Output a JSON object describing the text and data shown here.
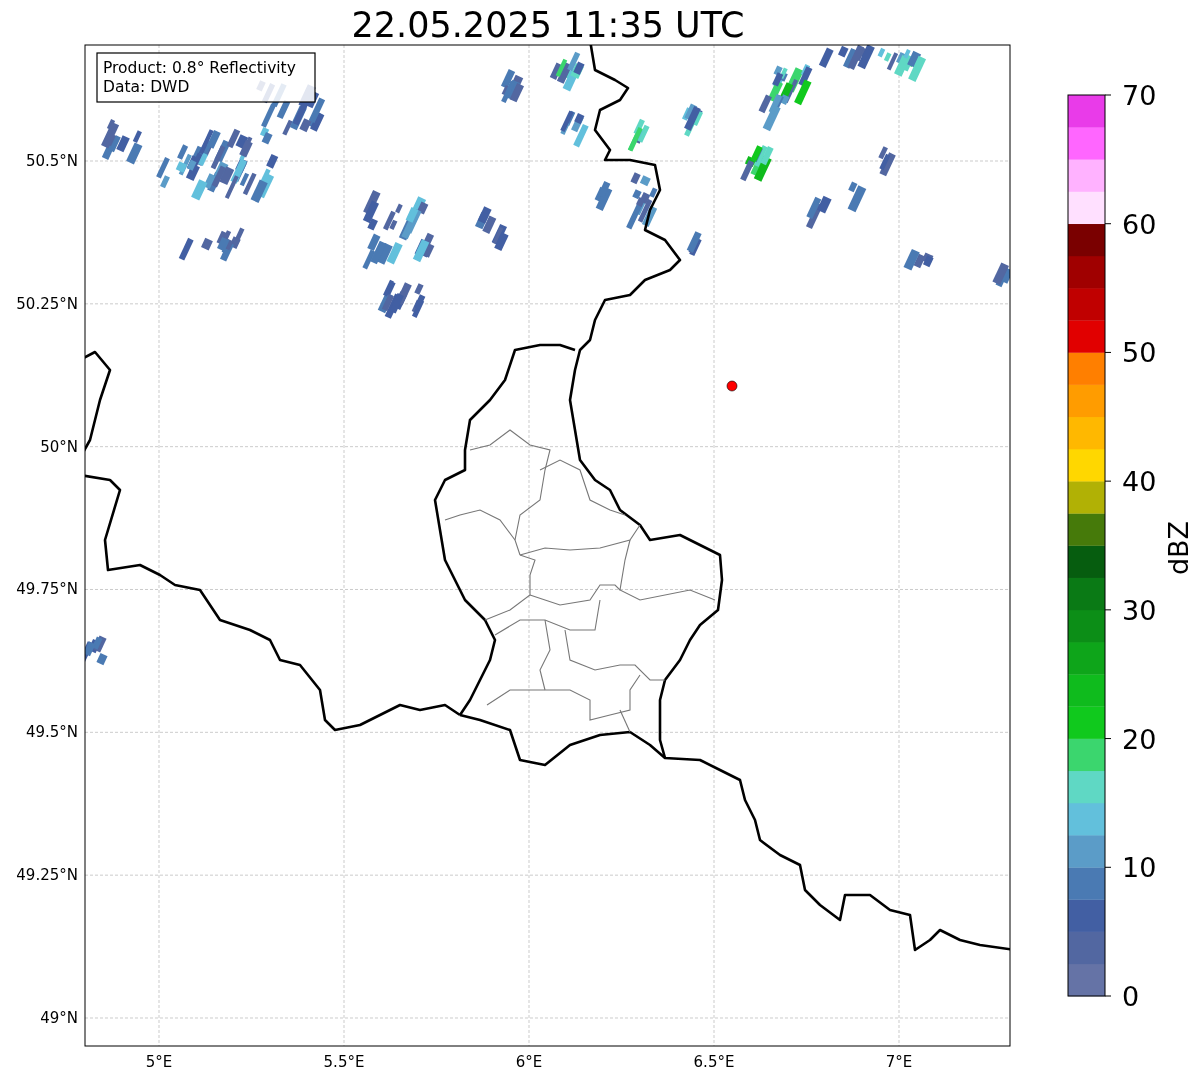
{
  "title": "22.05.2025 11:35 UTC",
  "info_box": {
    "lines": [
      "Product: 0.8° Reflectivity",
      "Data: DWD"
    ]
  },
  "map": {
    "lat_ticks": [
      "50.5°N",
      "50.25°N",
      "50°N",
      "49.75°N",
      "49.5°N",
      "49.25°N",
      "49°N"
    ],
    "lon_ticks": [
      "5°E",
      "5.5°E",
      "6°E",
      "6.5°E",
      "7°E"
    ]
  },
  "colorbar": {
    "label": "dBZ",
    "ticks": [
      "70",
      "60",
      "50",
      "40",
      "30",
      "20",
      "10",
      "0"
    ],
    "bins": [
      {
        "color": "#6573a6"
      },
      {
        "color": "#5267a1"
      },
      {
        "color": "#425fa3"
      },
      {
        "color": "#4a7ab3"
      },
      {
        "color": "#5b9cc8"
      },
      {
        "color": "#62c0dc"
      },
      {
        "color": "#5fd8c4"
      },
      {
        "color": "#3bd66e"
      },
      {
        "color": "#10c91d"
      },
      {
        "color": "#0fbb1d"
      },
      {
        "color": "#0ea51a"
      },
      {
        "color": "#0c8e17"
      },
      {
        "color": "#0a7a15"
      },
      {
        "color": "#065d0f"
      },
      {
        "color": "#467a0a"
      },
      {
        "color": "#b1b105"
      },
      {
        "color": "#ffd700"
      },
      {
        "color": "#ffb800"
      },
      {
        "color": "#ff9c00"
      },
      {
        "color": "#ff7f00"
      },
      {
        "color": "#e10000"
      },
      {
        "color": "#c00000"
      },
      {
        "color": "#a00000"
      },
      {
        "color": "#7a0000"
      },
      {
        "color": "#ffe0ff"
      },
      {
        "color": "#ffb2ff"
      },
      {
        "color": "#ff66ff"
      },
      {
        "color": "#e93be9"
      }
    ]
  }
}
